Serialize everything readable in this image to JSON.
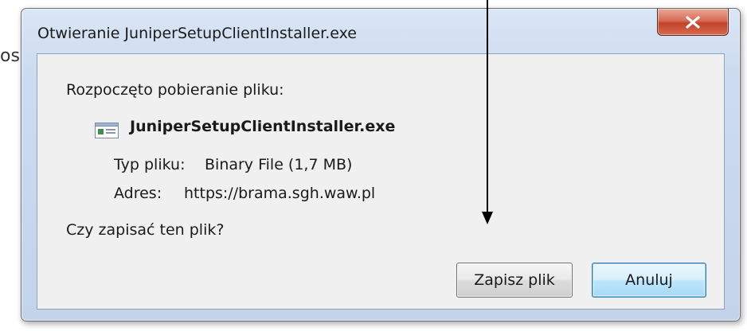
{
  "background": {
    "partial_text": "os"
  },
  "dialog": {
    "title": "Otwieranie JuniperSetupClientInstaller.exe",
    "intro": "Rozpoczęto pobieranie pliku:",
    "file_name": "JuniperSetupClientInstaller.exe",
    "type_label": "Typ pliku:",
    "type_value": "Binary File (1,7 MB)",
    "address_label": "Adres:",
    "address_value": "https://brama.sgh.waw.pl",
    "question": "Czy zapisać ten plik?",
    "save_label": "Zapisz plik",
    "cancel_label": "Anuluj"
  },
  "colors": {
    "close_button": "#c2432a",
    "default_button": "#bee6fd",
    "window_frame": "#c3d3ea"
  },
  "icons": {
    "close": "close-icon",
    "file": "file-icon"
  }
}
